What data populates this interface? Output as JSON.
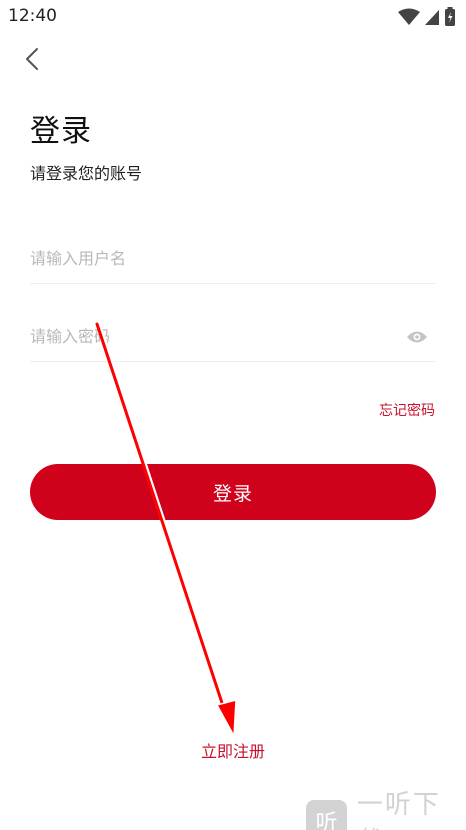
{
  "status_bar": {
    "time": "12:40"
  },
  "page": {
    "title": "登录",
    "subtitle": "请登录您的账号"
  },
  "form": {
    "username_placeholder": "请输入用户名",
    "password_placeholder": "请输入密码",
    "forgot_password": "忘记密码",
    "login_button": "登录"
  },
  "register_link": "立即注册",
  "watermark": {
    "logo": "听",
    "text": "一听下载"
  },
  "icons": {
    "back": "chevron-left-icon",
    "password_toggle": "eye-icon"
  },
  "colors": {
    "brand": "#d0021b",
    "link": "#c8102e",
    "annotation_arrow": "#ff0000"
  }
}
